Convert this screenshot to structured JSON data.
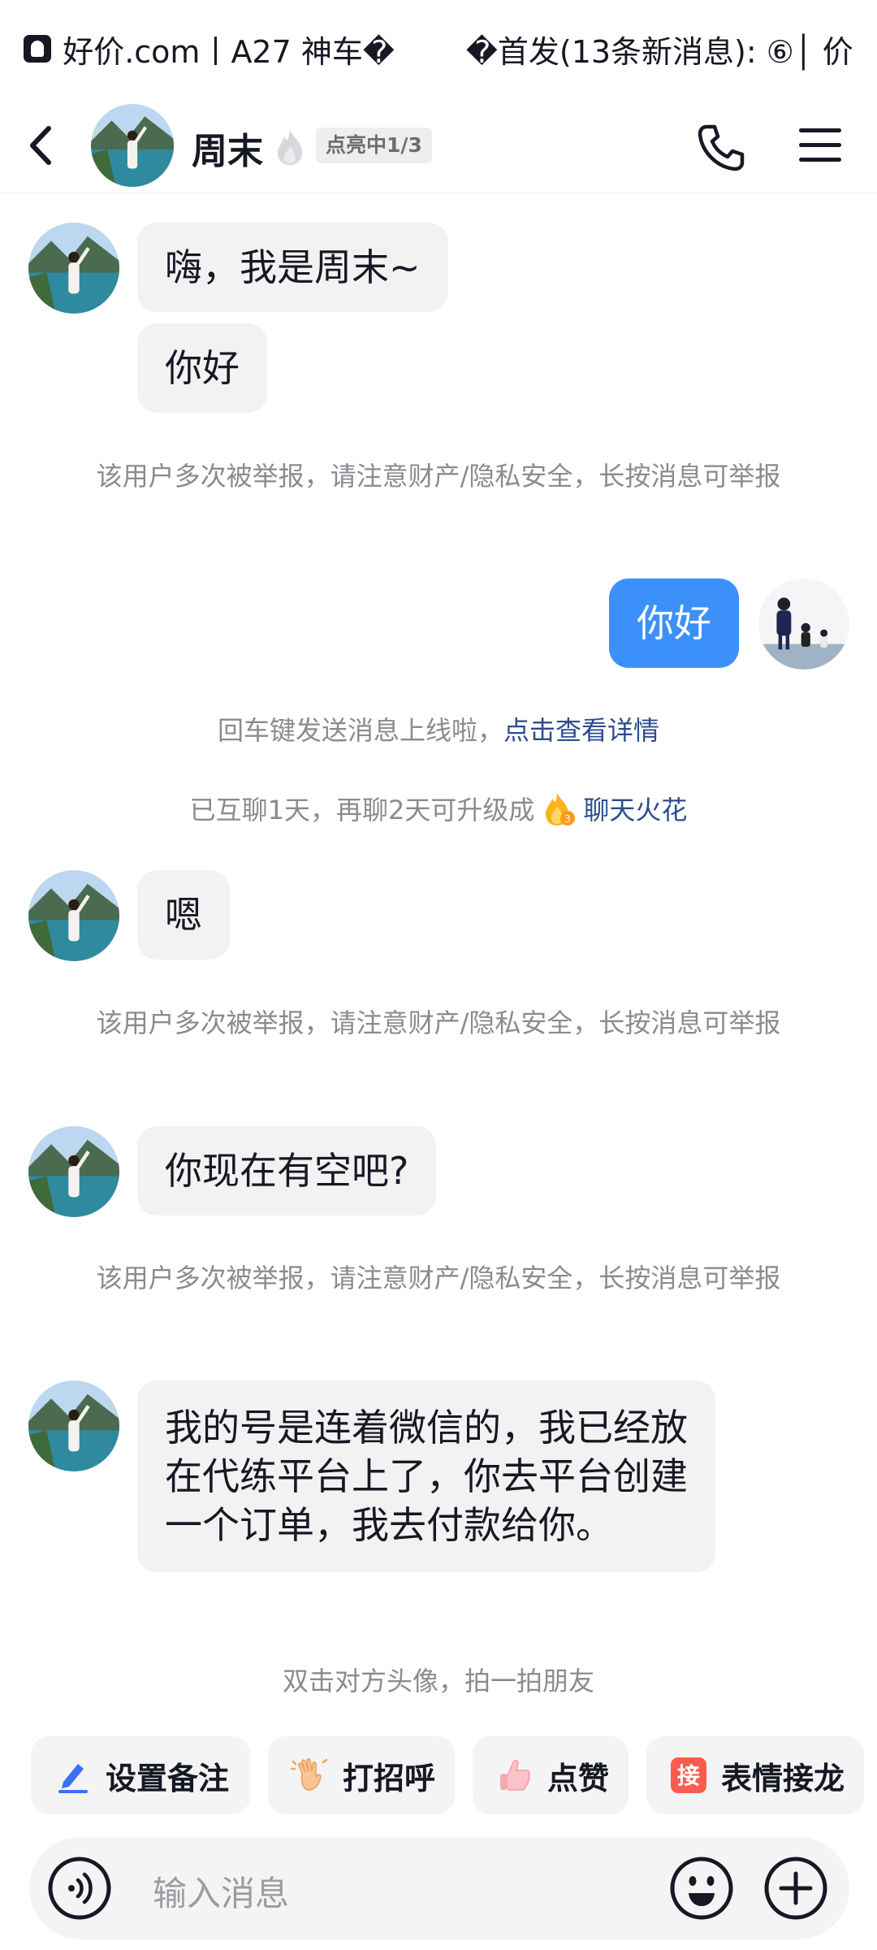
{
  "status_bar": {
    "text": "好价.com丨A27 神车�　　 �首发(13条新消息): ⑥│ 价"
  },
  "header": {
    "name": "周末",
    "light_badge": "点亮中1/3"
  },
  "messages": {
    "m1": "嗨，我是周末~",
    "m2": "你好",
    "warn1": "该用户多次被举报，请注意财产/隐私安全，长按消息可举报",
    "m3": "你好",
    "enter_notice": "回车键发送消息上线啦，",
    "enter_link": "点击查看详情",
    "spark_notice": "已互聊1天，再聊2天可升级成",
    "spark_link": "聊天火花",
    "m4": "嗯",
    "warn2": "该用户多次被举报，请注意财产/隐私安全，长按消息可举报",
    "m5": "你现在有空吧?",
    "warn3": "该用户多次被举报，请注意财产/隐私安全，长按消息可举报",
    "m6": "我的号是连着微信的，我已经放在代练平台上了，你去平台创建一个订单，我去付款给你。",
    "pat_hint": "双击对方头像，拍一拍朋友"
  },
  "quick_actions": {
    "remark": "设置备注",
    "greet": "打招呼",
    "like": "点赞",
    "emoji_chain": "表情接龙",
    "emoji_chain_icon_char": "接"
  },
  "input": {
    "placeholder": "输入消息"
  },
  "colors": {
    "my_bubble": "#3b91f9",
    "their_bubble": "#f2f2f3",
    "link": "#2b4d8f"
  }
}
